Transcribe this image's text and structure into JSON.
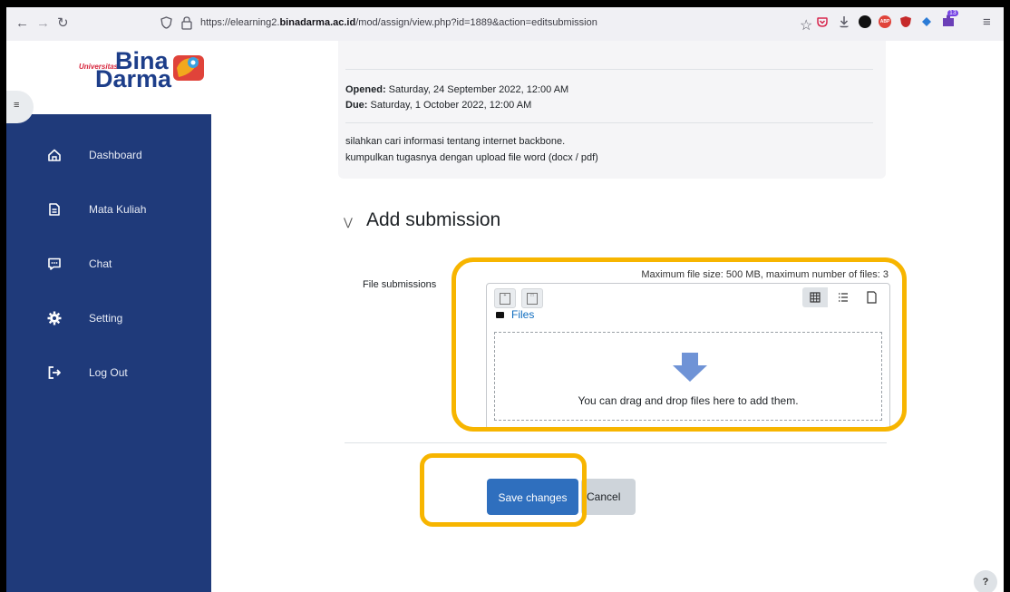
{
  "browser": {
    "url_prefix": "https://elearning2.",
    "url_domain": "binadarma.ac.id",
    "url_path": "/mod/assign/view.php?id=1889&action=editsubmission",
    "extension_badge": "13",
    "adblock_label": "ABP"
  },
  "logo": {
    "universitas": "Universitas",
    "bina": "Bina",
    "darma": "Darma"
  },
  "sidebar": {
    "items": [
      {
        "label": "Dashboard",
        "icon": "home-icon"
      },
      {
        "label": "Mata Kuliah",
        "icon": "document-icon"
      },
      {
        "label": "Chat",
        "icon": "chat-icon"
      },
      {
        "label": "Setting",
        "icon": "gear-icon"
      },
      {
        "label": "Log Out",
        "icon": "logout-icon"
      }
    ]
  },
  "assignment": {
    "opened_label": "Opened:",
    "opened_value": " Saturday, 24 September 2022, 12:00 AM",
    "due_label": "Due:",
    "due_value": " Saturday, 1 October 2022, 12:00 AM",
    "description_line1": "silahkan cari informasi tentang internet backbone.",
    "description_line2": "kumpulkan tugasnya dengan upload file word (docx / pdf)"
  },
  "submission": {
    "section_title": "Add submission",
    "file_label": "File submissions",
    "max_size_text": "Maximum file size: 500 MB, maximum number of files: 3",
    "files_link": "Files",
    "drop_text": "You can drag and drop files here to add them."
  },
  "actions": {
    "save_label": "Save changes",
    "cancel_label": "Cancel"
  },
  "help_label": "?",
  "colors": {
    "sidebar": "#1f3a7a",
    "primary_button": "#2f6fbe",
    "highlight": "#f7b500",
    "link": "#0f6cbf"
  }
}
